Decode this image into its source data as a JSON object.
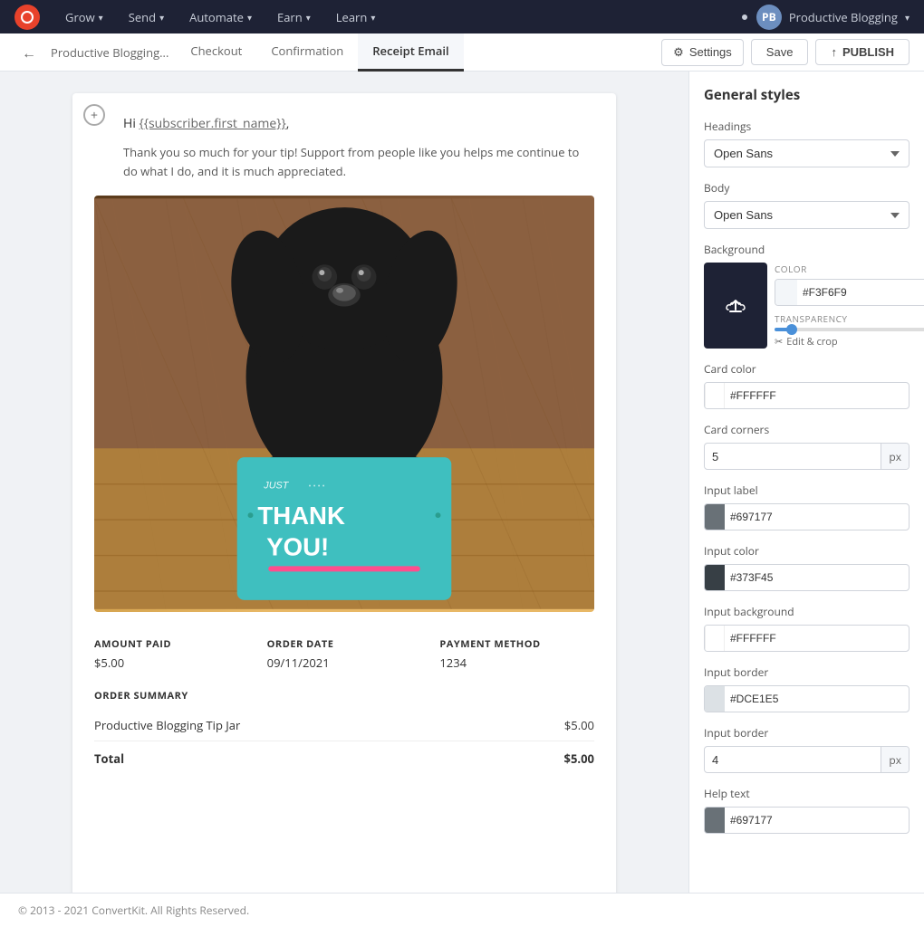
{
  "app": {
    "logo_alt": "ConvertKit",
    "nav_items": [
      {
        "label": "Grow",
        "has_dropdown": true
      },
      {
        "label": "Send",
        "has_dropdown": true
      },
      {
        "label": "Automate",
        "has_dropdown": true
      },
      {
        "label": "Earn",
        "has_dropdown": true
      },
      {
        "label": "Learn",
        "has_dropdown": true
      }
    ],
    "user_name": "Productive Blogging",
    "notification_label": "notifications"
  },
  "subnav": {
    "back_label": "←",
    "breadcrumb": "Productive Blogging...",
    "tabs": [
      {
        "label": "Checkout",
        "active": false
      },
      {
        "label": "Confirmation",
        "active": false
      },
      {
        "label": "Receipt Email",
        "active": true
      }
    ],
    "settings_label": "Settings",
    "save_label": "Save",
    "publish_label": "PUBLISH"
  },
  "email": {
    "greeting": "Hi {{subscriber.first_name}},",
    "body": "Thank you so much for your tip! Support from people like you helps me continue to do what I do, and it is much appreciated.",
    "image_alt": "Thank You dog with card",
    "order_details": [
      {
        "label": "AMOUNT PAID",
        "value": "$5.00"
      },
      {
        "label": "ORDER DATE",
        "value": "09/11/2021"
      },
      {
        "label": "PAYMENT METHOD",
        "value": "1234"
      }
    ],
    "order_summary_title": "ORDER SUMMARY",
    "order_lines": [
      {
        "name": "Productive Blogging Tip Jar",
        "price": "$5.00"
      }
    ],
    "total_label": "Total",
    "total_value": "$5.00"
  },
  "panel": {
    "title": "General styles",
    "headings_label": "Headings",
    "headings_font": "Open Sans",
    "body_label": "Body",
    "body_font": "Open Sans",
    "background_label": "Background",
    "bg_color_label": "COLOR",
    "bg_color_value": "#F3F6F9",
    "bg_transparency_label": "TRANSPARENCY",
    "bg_transparency_value": "7%",
    "bg_transparency_percent": 7,
    "edit_crop_label": "Edit & crop",
    "card_color_label": "Card color",
    "card_color_value": "#FFFFFF",
    "card_corners_label": "Card corners",
    "card_corners_value": "5",
    "card_corners_unit": "px",
    "input_label_label": "Input label",
    "input_label_color": "#697177",
    "input_color_label": "Input color",
    "input_color_value": "#373F45",
    "input_bg_label": "Input background",
    "input_bg_value": "#FFFFFF",
    "input_border_label": "Input border",
    "input_border_color": "#DCE1E5",
    "input_border2_label": "Input border",
    "input_border2_value": "4",
    "input_border2_unit": "px",
    "help_text_label": "Help text",
    "help_text_color": "#697177"
  },
  "footer": {
    "text": "© 2013 - 2021 ConvertKit. All Rights Reserved."
  }
}
